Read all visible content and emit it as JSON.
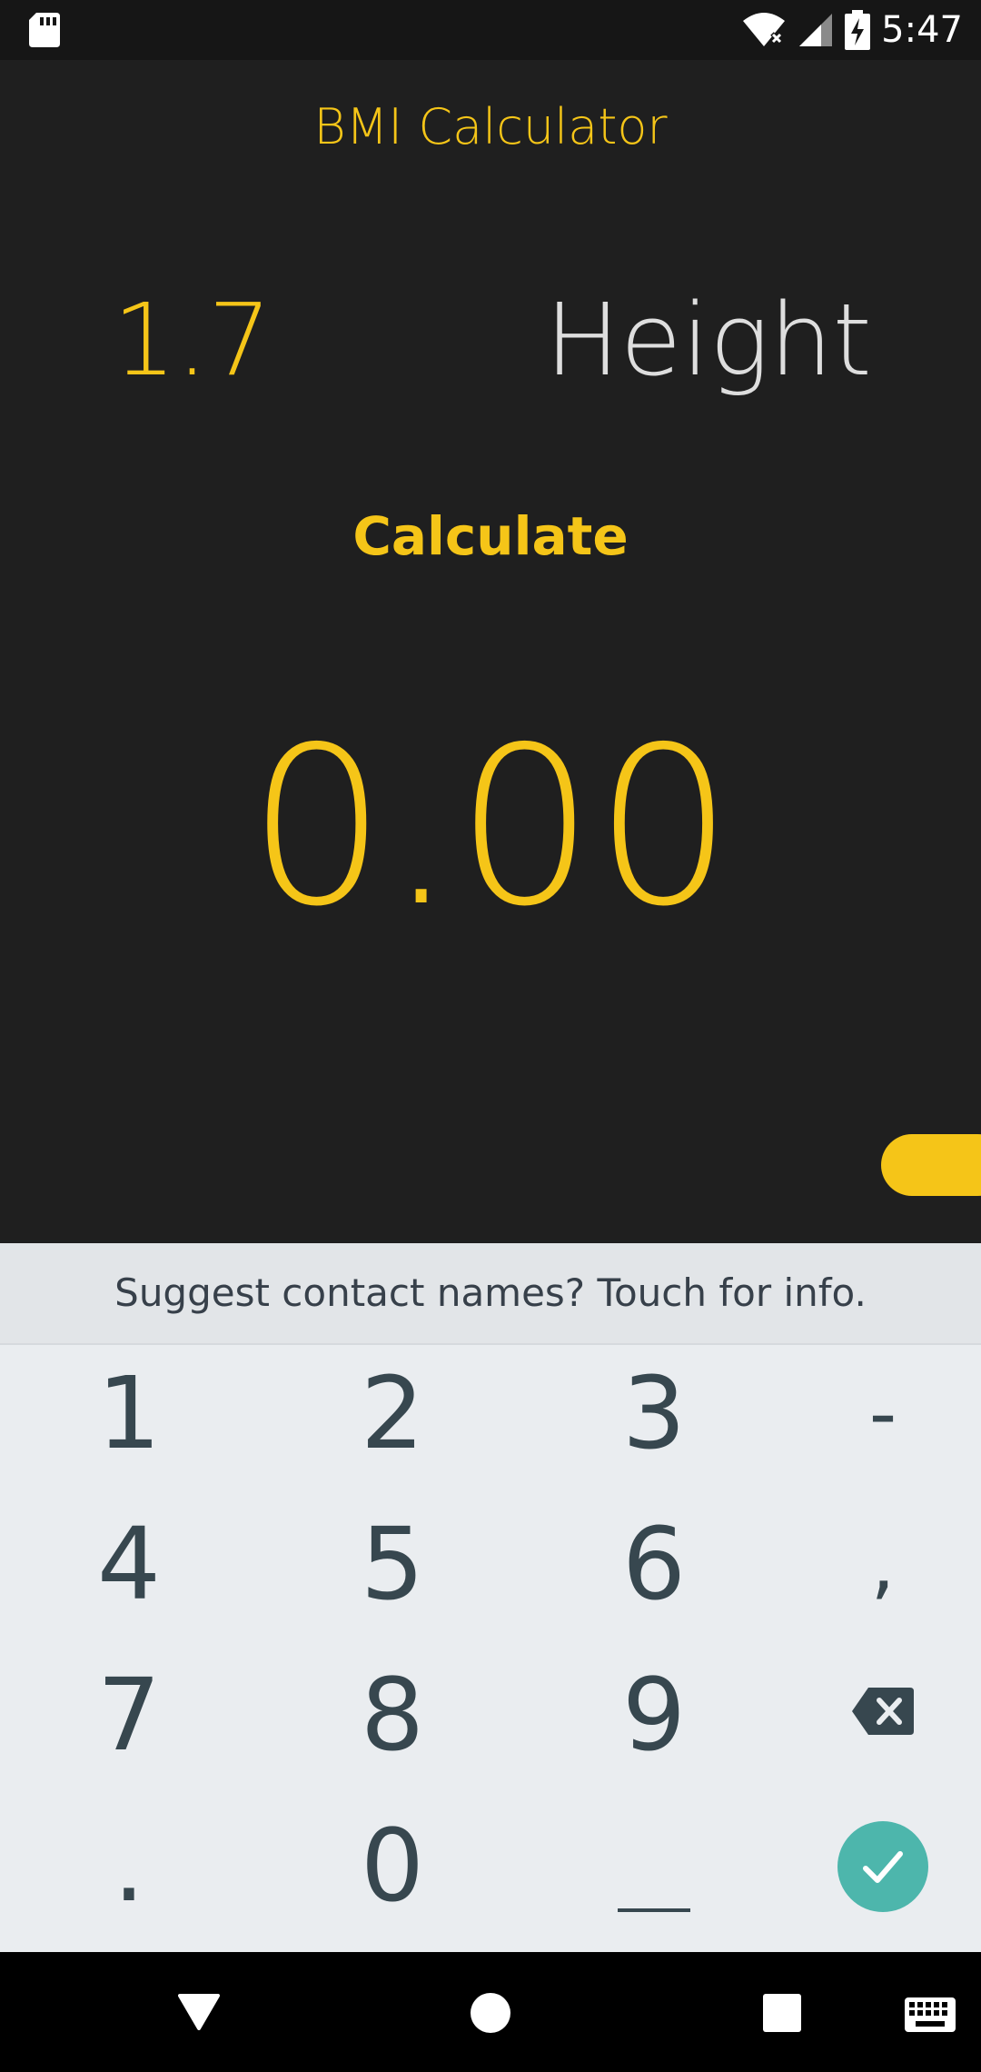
{
  "status_bar": {
    "time": "5:47",
    "icons": [
      "sd-card-icon",
      "wifi-icon",
      "signal-icon",
      "battery-icon"
    ]
  },
  "app": {
    "title": "BMI Calculator",
    "height_value": "1.7",
    "height_label": "Height",
    "calculate_label": "Calculate",
    "result": "0.00"
  },
  "colors": {
    "accent": "#f5c518",
    "background": "#1f1f1f",
    "keyboard_bg": "#eaedf0",
    "done_key": "#4db6ac"
  },
  "keyboard": {
    "suggestion": "Suggest contact names? Touch for info.",
    "rows": [
      [
        "1",
        "2",
        "3",
        "-"
      ],
      [
        "4",
        "5",
        "6",
        ","
      ],
      [
        "7",
        "8",
        "9",
        "backspace"
      ],
      [
        ".",
        "0",
        "space",
        "done"
      ]
    ]
  },
  "nav_bar": {
    "icons": [
      "back-icon",
      "home-icon",
      "recents-icon",
      "keyboard-icon"
    ]
  }
}
